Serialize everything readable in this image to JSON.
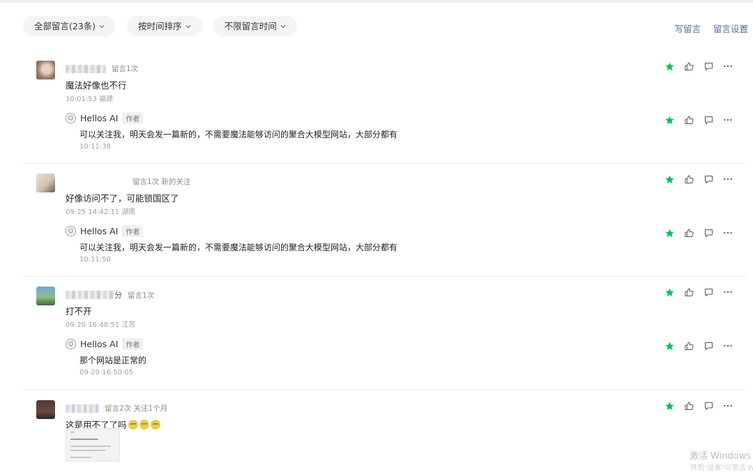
{
  "filters": [
    {
      "label": "全部留言(23条)"
    },
    {
      "label": "按时间排序"
    },
    {
      "label": "不限留言时间"
    }
  ],
  "top_links": {
    "write": "写留言",
    "settings": "留言设置"
  },
  "comments": [
    {
      "meta": "留言1次",
      "text": "魔法好像也不行",
      "time": "10:01:53 福建",
      "reply": {
        "name": "Hellos AI",
        "badge": "作者",
        "text": "可以关注我，明天会发一篇新的，不需要魔法能够访问的聚合大模型网站，大部分都有",
        "time": "10:11:38"
      }
    },
    {
      "meta": "留言1次 新的关注",
      "text": "好像访问不了，可能锁国区了",
      "time": "09-25 14:42:11 湖南",
      "reply": {
        "name": "Hellos AI",
        "badge": "作者",
        "text": "可以关注我，明天会发一篇新的，不需要魔法能够访问的聚合大模型网站，大部分都有",
        "time": "10:11:50"
      }
    },
    {
      "name_suffix": "分",
      "meta": "留言1次",
      "text": "打不开",
      "time": "09-20 16:48:51 江苏",
      "reply": {
        "name": "Hellos AI",
        "badge": "作者",
        "text": "那个网站是正常的",
        "time": "09-20 16:50:05"
      }
    },
    {
      "meta": "留言2次 关注1个月",
      "text": "这是用不了了吗"
    }
  ],
  "watermark": {
    "line1": "激活 Windows",
    "line2": "转到\"设置\"以激活 W"
  },
  "colors": {
    "star": "#07c160",
    "link": "#576b95"
  },
  "icons": [
    "chevron-down-icon",
    "star-icon",
    "thumbs-up-icon",
    "comment-icon",
    "more-icon"
  ]
}
